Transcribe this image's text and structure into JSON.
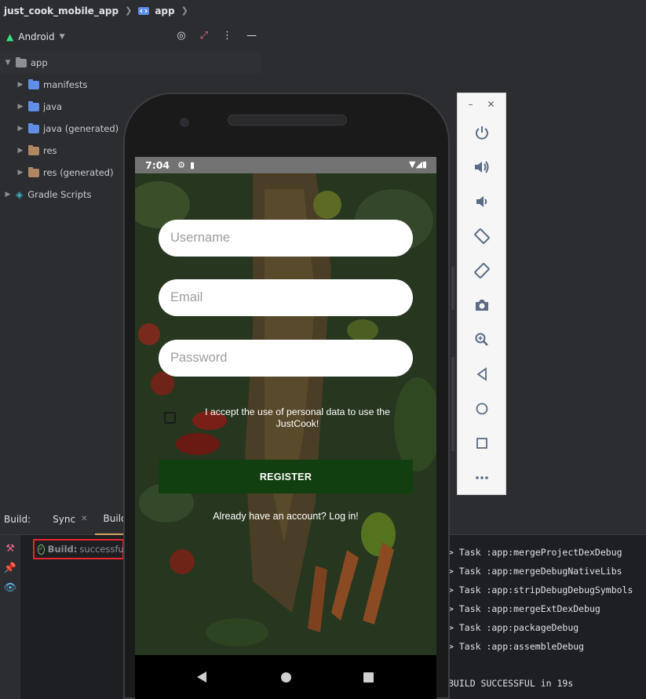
{
  "breadcrumb": {
    "project": "just_cook_mobile_app",
    "module": "app"
  },
  "project_panel": {
    "view_label": "Android",
    "tree": [
      {
        "label": "app",
        "level": 0,
        "icon": "module-folder-icon",
        "color": "#8c8f94"
      },
      {
        "label": "manifests",
        "level": 1,
        "icon": "folder-icon",
        "color": "#5e8ee6"
      },
      {
        "label": "java",
        "level": 1,
        "icon": "folder-icon",
        "color": "#5e8ee6"
      },
      {
        "label": "java (generated)",
        "level": 1,
        "icon": "generated-folder-icon",
        "color": "#5e8ee6"
      },
      {
        "label": "res",
        "level": 1,
        "icon": "res-folder-icon",
        "color": "#b08760"
      },
      {
        "label": "res (generated)",
        "level": 1,
        "icon": "res-folder-icon",
        "color": "#b08760"
      },
      {
        "label": "Gradle Scripts",
        "level": 0,
        "icon": "gradle-icon",
        "color": "#3fb0c9"
      }
    ]
  },
  "build_panel": {
    "label": "Build:",
    "tabs": [
      "Sync",
      "Build O"
    ],
    "status_bold": "Build:",
    "status_text": "successful",
    "log": [
      "> Task :app:mergeProjectDexDebug",
      "> Task :app:mergeDebugNativeLibs",
      "> Task :app:stripDebugDebugSymbols",
      "> Task :app:mergeExtDexDebug",
      "> Task :app:packageDebug",
      "> Task :app:assembleDebug"
    ],
    "final": "BUILD SUCCESSFUL in 19s"
  },
  "emulator": {
    "controls": [
      "power-icon",
      "volume-up-icon",
      "volume-down-icon",
      "rotate-left-icon",
      "rotate-right-icon",
      "camera-icon",
      "zoom-icon",
      "back-icon",
      "home-icon",
      "overview-icon",
      "more-icon"
    ]
  },
  "app_screen": {
    "status_time": "7:04",
    "username_placeholder": "Username",
    "email_placeholder": "Email",
    "password_placeholder": "Password",
    "consent_text": "I accept the use of personal data to use the JustCook!",
    "register_label": "REGISTER",
    "login_link": "Already have an account? Log in!"
  },
  "colors": {
    "ide_bg": "#2b2d30",
    "console_bg": "#1e1f22",
    "register_button": "#123f0f",
    "highlight": "#e5262a",
    "success": "#6fbf73"
  }
}
